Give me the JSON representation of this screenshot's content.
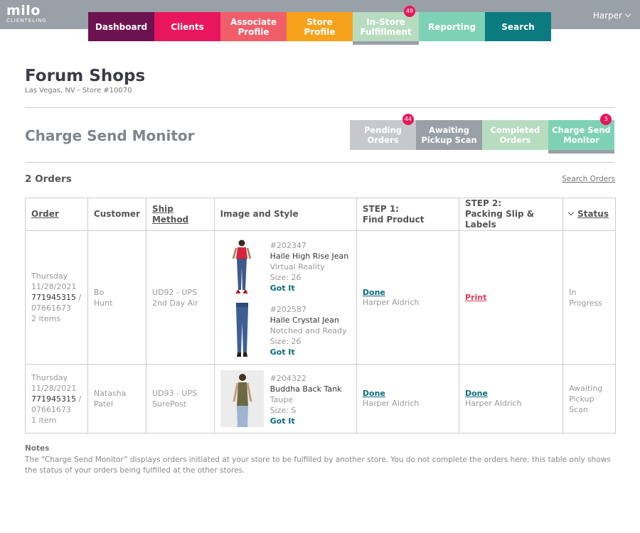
{
  "header": {
    "logo_main": "milo",
    "logo_sub": "CLIENTELING",
    "user": "Harper"
  },
  "nav": [
    {
      "label": "Dashboard",
      "color": "#6d1250"
    },
    {
      "label": "Clients",
      "color": "#e8175d"
    },
    {
      "label": "Associate\nProfile",
      "color": "#f05e6a"
    },
    {
      "label": "Store\nProfile",
      "color": "#f7a21b"
    },
    {
      "label": "In-Store\nFulfillment",
      "color": "#b8dcc0",
      "badge": "49",
      "active": true
    },
    {
      "label": "Reporting",
      "color": "#7fd1b6"
    },
    {
      "label": "Search",
      "color": "#0b7b80"
    }
  ],
  "store": {
    "title": "Forum Shops",
    "subtitle": "Las Vegas, NV - Store #10070"
  },
  "page_title": "Charge Send Monitor",
  "subnav": [
    {
      "label": "Pending\nOrders",
      "color": "#c6c9cc",
      "badge": "44"
    },
    {
      "label": "Awaiting\nPickup Scan",
      "color": "#9aa0a7"
    },
    {
      "label": "Completed\nOrders",
      "color": "#b8dcc0"
    },
    {
      "label": "Charge Send\nMonitor",
      "color": "#7fd1b6",
      "badge": "3",
      "active": true
    }
  ],
  "orders_count": "2 Orders",
  "search_orders": "Search Orders",
  "table": {
    "headers": {
      "order": "Order",
      "customer": "Customer",
      "ship": "Ship Method",
      "image": "Image and Style",
      "step1_a": "STEP 1:",
      "step1_b": "Find Product",
      "step2_a": "STEP 2:",
      "step2_b": "Packing Slip & Labels",
      "status": "Status"
    },
    "rows": [
      {
        "day": "Thursday",
        "date": "11/28/2021",
        "order_no": "771945315",
        "order_sep": " /",
        "order_alt": "07661673",
        "items": "2 items",
        "customer_first": "Bo",
        "customer_last": "Hunt",
        "ship_a": "UD92 - UPS",
        "ship_b": "2nd Day Air",
        "products": [
          {
            "sku": "#202347",
            "name": "Halle High Rise Jean",
            "color": "Virtual Reality",
            "size": "Size: 26",
            "action": "Got It"
          },
          {
            "sku": "#202587",
            "name": "Halle Crystal Jean",
            "color": "Notched and Ready",
            "size": "Size: 26",
            "action": "Got It"
          }
        ],
        "step1_link": "Done",
        "step1_by": "Harper Aldrich",
        "step2_link": "Print",
        "status": "In Progress"
      },
      {
        "day": "Thursday",
        "date": "11/28/2021",
        "order_no": "771945315",
        "order_sep": " /",
        "order_alt": "07661673",
        "items": "1 item",
        "customer_first": "Natasha",
        "customer_last": "Patel",
        "ship_a": "UD93 - UPS",
        "ship_b": "SurePost",
        "products": [
          {
            "sku": "#204322",
            "name": "Buddha Back Tank",
            "color": "Taupe",
            "size": "Size: S",
            "action": "Got It"
          }
        ],
        "step1_link": "Done",
        "step1_by": "Harper Aldrich",
        "step2_link": "Done",
        "step2_by": "Harper Aldrich",
        "status_a": "Awaiting",
        "status_b": "Pickup",
        "status_c": "Scan"
      }
    ]
  },
  "notes": {
    "title": "Notes",
    "body": "The “Charge Send Monitor” displays orders initiated at your store to be fulfilled by another store. You do not complete the orders here: this table only shows the status of your orders being fulfilled at the other stores."
  },
  "colors": {
    "topbar": "#9aa0a7",
    "badge": "#e8175d",
    "link_teal": "#0b6b78",
    "link_red": "#e23b57"
  }
}
